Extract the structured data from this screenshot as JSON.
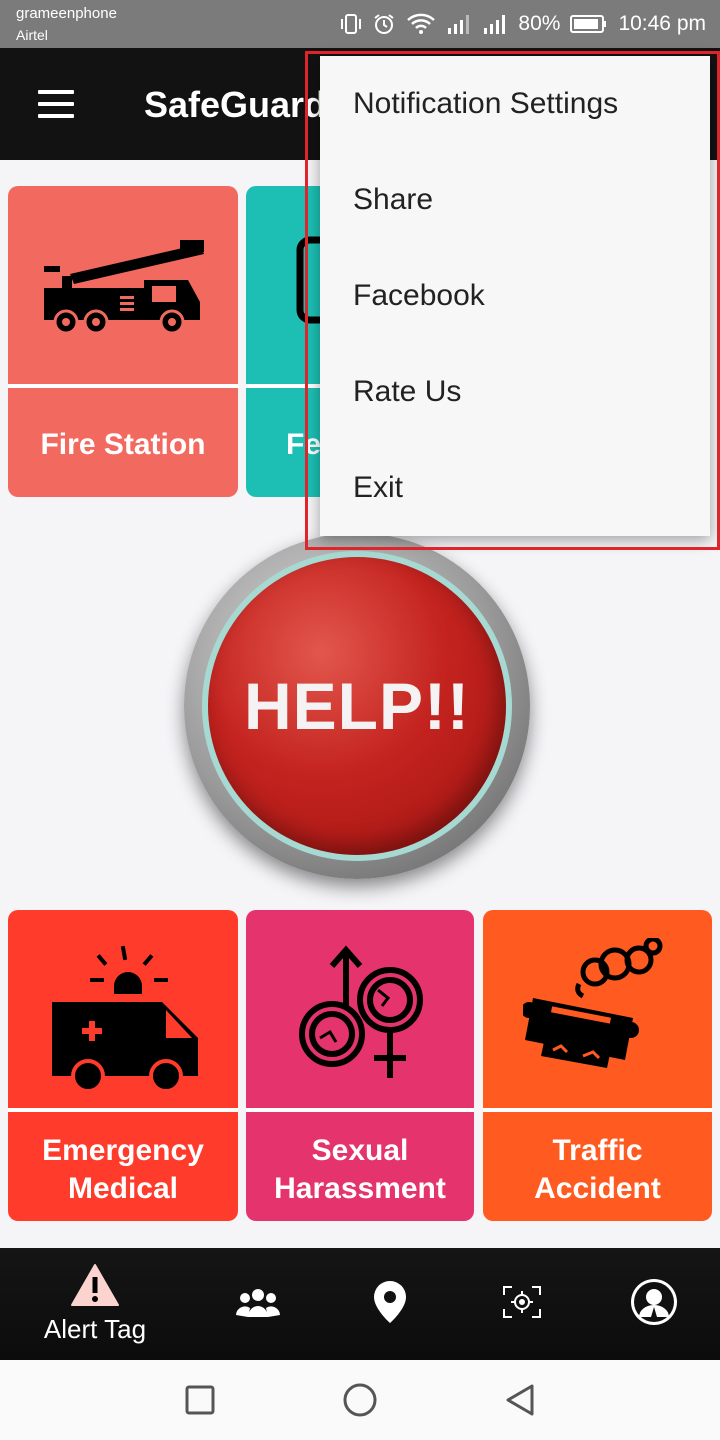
{
  "status_bar": {
    "carrier_primary": "grameenphone",
    "carrier_secondary": "Airtel",
    "battery": "80%",
    "time": "10:46 pm"
  },
  "app_bar": {
    "title": "SafeGuard"
  },
  "tiles": {
    "fire_station": {
      "label": "Fire Station",
      "color": "#f26a5f"
    },
    "second": {
      "label": "Fe",
      "color": "#1dbfb4"
    },
    "emergency_medical": {
      "label_line1": "Emergency",
      "label_line2": "Medical",
      "color": "#ff3b2b"
    },
    "sexual_harassment": {
      "label_line1": "Sexual",
      "label_line2": "Harassment",
      "color": "#e5336d"
    },
    "traffic_accident": {
      "label_line1": "Traffic",
      "label_line2": "Accident",
      "color": "#ff5a1f"
    }
  },
  "help_button": {
    "label": "HELP!!"
  },
  "overflow_menu": {
    "items": [
      "Notification Settings",
      "Share",
      "Facebook",
      "Rate Us",
      "Exit"
    ]
  },
  "bottom_nav": {
    "alert_tag_label": "Alert Tag",
    "icons": [
      "alert-triangle-icon",
      "group-icon",
      "location-pin-icon",
      "target-scan-icon",
      "profile-icon"
    ]
  },
  "colors": {
    "highlight_border": "#e0242c",
    "app_bar": "#121212"
  }
}
